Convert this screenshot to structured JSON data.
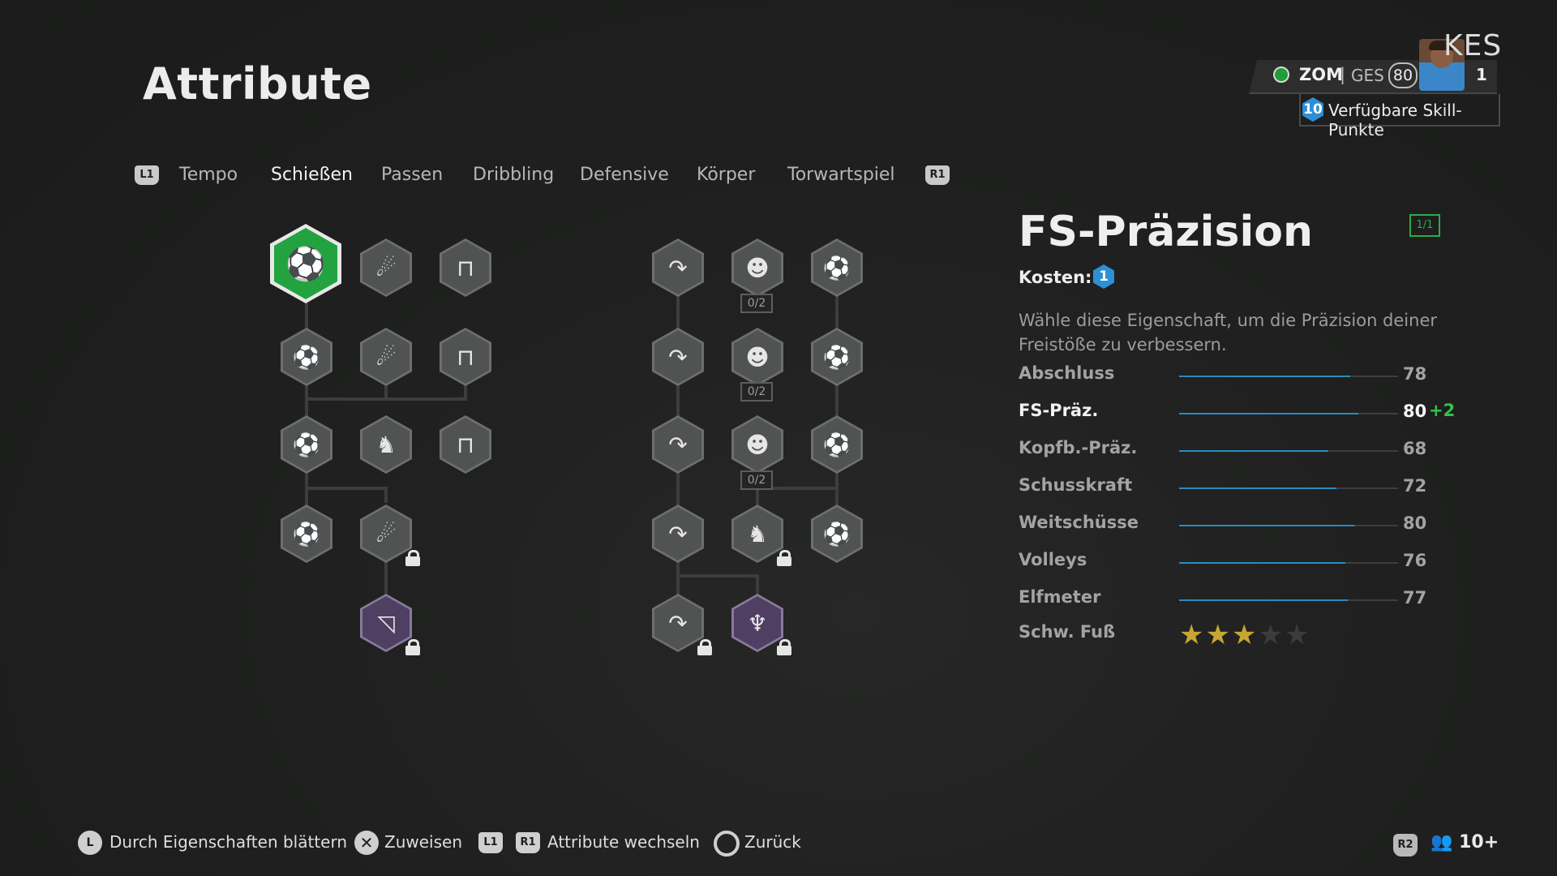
{
  "page": {
    "title": "Attribute"
  },
  "player": {
    "name": "KES",
    "club": "ZOM",
    "separator": "|",
    "ges_label": "GES",
    "overall": "80",
    "count": "1",
    "skill_points": "10",
    "skill_points_label": "Verfügbare Skill-Punkte",
    "status_color": "#1f9e38"
  },
  "tabs": {
    "left_button": "L1",
    "right_button": "R1",
    "items": [
      "Tempo",
      "Schießen",
      "Passen",
      "Dribbling",
      "Defensive",
      "Körper",
      "Torwartspiel"
    ],
    "active_index": 1
  },
  "tree": {
    "counters": [
      "0/2",
      "0/2",
      "0/2"
    ],
    "icons": [
      "free-kick-icon",
      "power-shot-icon",
      "goal-post-icon",
      "curve-shot-icon",
      "header-icon",
      "boot-ball-icon",
      "lion-icon",
      "eagle-icon",
      "target-goal-icon"
    ]
  },
  "detail": {
    "title": "FS-Präzision",
    "ratio": "1/1",
    "cost_label": "Kosten:",
    "cost_value": "1",
    "description": "Wähle diese Eigenschaft, um die Präzision deiner Freistöße zu verbessern.",
    "stats": [
      {
        "name": "Abschluss",
        "value": "78",
        "fill": 0.78
      },
      {
        "name": "FS-Präz.",
        "value": "80",
        "plus": "+2",
        "fill": 0.82
      },
      {
        "name": "Kopfb.-Präz.",
        "value": "68",
        "fill": 0.68
      },
      {
        "name": "Schusskraft",
        "value": "72",
        "fill": 0.72
      },
      {
        "name": "Weitschüsse",
        "value": "80",
        "fill": 0.8
      },
      {
        "name": "Volleys",
        "value": "76",
        "fill": 0.76
      },
      {
        "name": "Elfmeter",
        "value": "77",
        "fill": 0.77
      }
    ],
    "weak_foot": {
      "name": "Schw. Fuß",
      "stars": 3,
      "max": 5
    },
    "accent_color": "#36c04f"
  },
  "footer": {
    "l_button": "L",
    "browse": "Durch Eigenschaften blättern",
    "assign": "Zuweisen",
    "l1": "L1",
    "r1": "R1",
    "switch": "Attribute wechseln",
    "back": "Zurück",
    "r2": "R2",
    "players": "10+"
  }
}
